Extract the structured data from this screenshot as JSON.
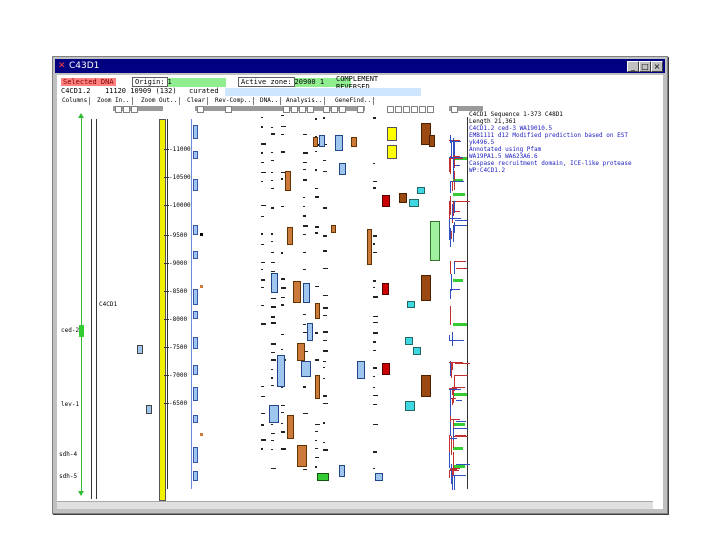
{
  "window": {
    "title": "C43D1",
    "buttons": [
      "_",
      "□",
      "×"
    ]
  },
  "toolbar_row1": {
    "selected_dna_label": "Selected DNA",
    "origin_label": "Origin:",
    "origin_value": "1",
    "active_zone_label": "Active zone:",
    "active_zone_value": "20900 1",
    "strand": [
      "COMPLEMENT",
      "REVERSED"
    ]
  },
  "toolbar_row2": {
    "seq_name": "C4CD1.2",
    "coords": "11120  10909 (132)",
    "status": "curated"
  },
  "buttons": [
    "Columns",
    "Zoom In..",
    "Zoom Out..",
    "Clear",
    "Rev-Comp..",
    "DNA..",
    "Analysis..",
    "GeneFind.."
  ],
  "ruler": {
    "ticks": [
      "-11000",
      "-10500",
      "-10000",
      "-9500",
      "-9000",
      "-8500",
      "-8000",
      "-7500",
      "-7000",
      "-6500"
    ]
  },
  "left_labels": {
    "clone": "C4CD1",
    "markers": [
      "ced-2",
      "lev-1",
      "sdh-4",
      "sdh-5"
    ]
  },
  "info_panel": {
    "lines": [
      "C4CD1          Sequence 1-373 C48D1",
      "               Length 21,361",
      "C4CD1.2        ced-3 WA19010.5",
      "EMB1111 d12 Modified prediction based on EST",
      "               yk496.5",
      "               Annotated using Pfam",
      "               WA19PA1.5 WA623A6.6",
      "Caspase recruitment domain, ICE-like protease",
      "               WP:C4CD1.2"
    ]
  },
  "colors": {
    "accent_yellow": "#f0f000",
    "feature_orange": "#cc7a3a",
    "feature_blue": "#9ec6ee",
    "feature_green": "#33cc33",
    "titlebar": "#000080",
    "marker_green": "#33bb33",
    "info_text": "#2020c0"
  }
}
